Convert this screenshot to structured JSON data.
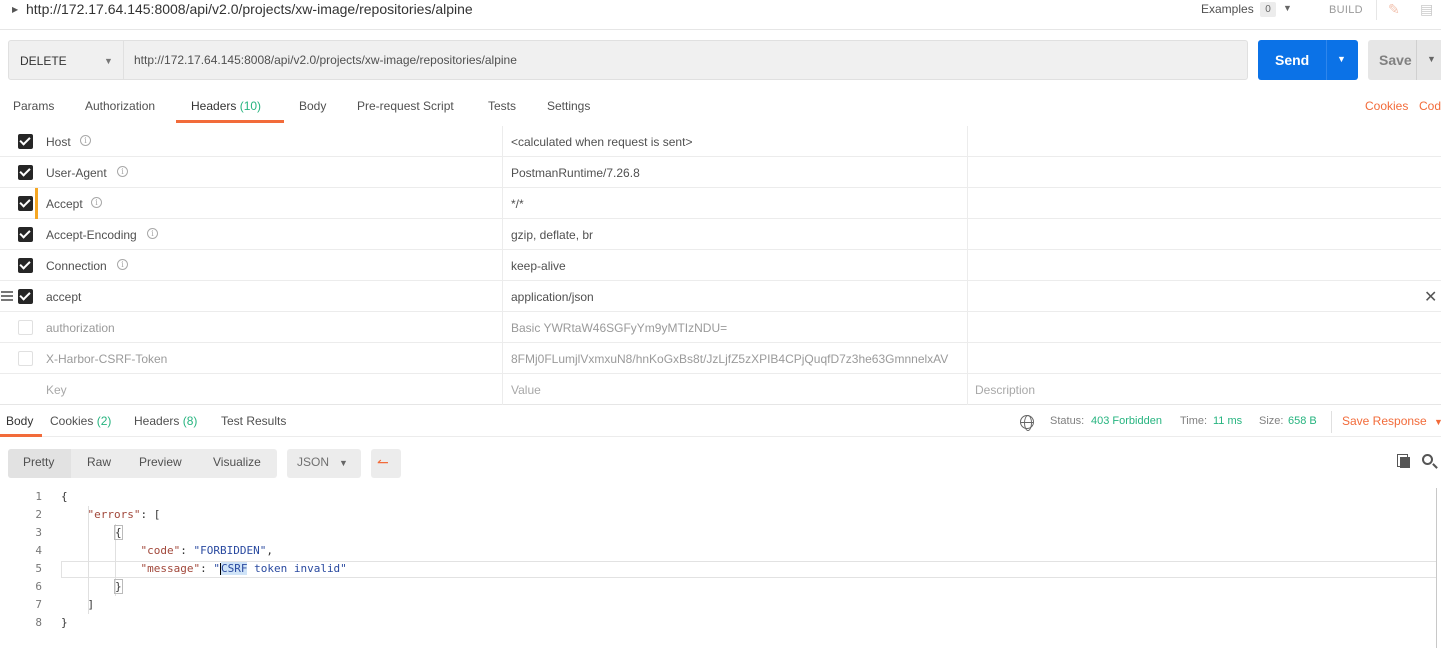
{
  "titlebar": {
    "title": "http://172.17.64.145:8008/api/v2.0/projects/xw-image/repositories/alpine",
    "examples_label": "Examples",
    "examples_count": "0",
    "build_label": "BUILD"
  },
  "request": {
    "method": "DELETE",
    "url": "http://172.17.64.145:8008/api/v2.0/projects/xw-image/repositories/alpine",
    "send_label": "Send",
    "save_label": "Save"
  },
  "request_tabs": {
    "params": "Params",
    "authorization": "Authorization",
    "headers": "Headers",
    "headers_count": "(10)",
    "body": "Body",
    "prerequest": "Pre-request Script",
    "tests": "Tests",
    "settings": "Settings",
    "cookies": "Cookies",
    "code": "Cod"
  },
  "headers": {
    "rows": [
      {
        "key": "Host",
        "value": "<calculated when request is sent>",
        "enabled": true,
        "info": true
      },
      {
        "key": "User-Agent",
        "value": "PostmanRuntime/7.26.8",
        "enabled": true,
        "info": true
      },
      {
        "key": "Accept",
        "value": "*/*",
        "enabled": true,
        "info": true
      },
      {
        "key": "Accept-Encoding",
        "value": "gzip, deflate, br",
        "enabled": true,
        "info": true
      },
      {
        "key": "Connection",
        "value": "keep-alive",
        "enabled": true,
        "info": true
      },
      {
        "key": "accept",
        "value": "application/json",
        "enabled": true,
        "info": false
      },
      {
        "key": "authorization",
        "value": "Basic YWRtaW46SGFyYm9yMTIzNDU=",
        "enabled": false,
        "info": false
      },
      {
        "key": "X-Harbor-CSRF-Token",
        "value": "8FMj0FLumjlVxmxuN8/hnKoGxBs8t/JzLjfZ5zXPIB4CPjQuqfD7z3he63GmnnelxAV",
        "enabled": false,
        "info": false
      }
    ],
    "placeholder_key": "Key",
    "placeholder_value": "Value",
    "placeholder_description": "Description"
  },
  "response_tabs": {
    "body": "Body",
    "cookies": "Cookies",
    "cookies_count": "(2)",
    "headers": "Headers",
    "headers_count": "(8)",
    "test_results": "Test Results"
  },
  "status": {
    "status_label": "Status:",
    "status_value": "403 Forbidden",
    "time_label": "Time:",
    "time_value": "11 ms",
    "size_label": "Size:",
    "size_value": "658 B",
    "save_response": "Save Response"
  },
  "view": {
    "pretty": "Pretty",
    "raw": "Raw",
    "preview": "Preview",
    "visualize": "Visualize",
    "format": "JSON"
  },
  "code": {
    "line_numbers": [
      "1",
      "2",
      "3",
      "4",
      "5",
      "6",
      "7",
      "8"
    ],
    "errors_key": "\"errors\"",
    "code_key": "\"code\"",
    "code_value": "\"FORBIDDEN\"",
    "message_key": "\"message\"",
    "message_selected": "CSRF",
    "message_rest": " token invalid\""
  },
  "colors": {
    "accent": "#f26b3a",
    "send_blue": "#0b72e7",
    "status_green": "#26b47f"
  }
}
